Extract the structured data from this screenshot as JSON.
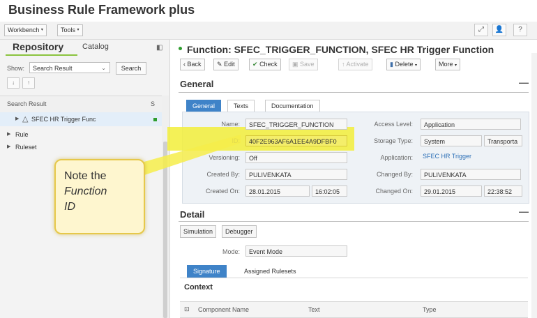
{
  "app": {
    "title": "Business Rule Framework plus"
  },
  "menubar": {
    "workbench": "Workbench",
    "tools": "Tools"
  },
  "left_panel": {
    "tab_repository": "Repository",
    "tab_catalog": "Catalog",
    "show_label": "Show:",
    "show_value": "Search Result",
    "search_button": "Search",
    "results_header": "Search Result",
    "results_col_s": "S",
    "tree": [
      {
        "label": "SFEC HR Trigger Func"
      },
      {
        "label": "Rule"
      },
      {
        "label": "Ruleset"
      }
    ]
  },
  "function": {
    "title": "Function: SFEC_TRIGGER_FUNCTION, SFEC HR Trigger Function"
  },
  "toolbar": {
    "back": "Back",
    "edit": "Edit",
    "check": "Check",
    "save": "Save",
    "activate": "Activate",
    "delete": "Delete",
    "more": "More"
  },
  "general": {
    "title": "General",
    "tabs": [
      "General",
      "Texts",
      "Documentation"
    ],
    "fields": {
      "name_label": "Name:",
      "name_value": "SFEC_TRIGGER_FUNCTION",
      "id_label": "ID:",
      "id_value": "40F2E963AF6A1EE4A9DFBF0",
      "versioning_label": "Versioning:",
      "versioning_value": "Off",
      "created_by_label": "Created By:",
      "created_by_value": "PULIVENKATA",
      "created_on_label": "Created On:",
      "created_on_date": "28.01.2015",
      "created_on_time": "16:02:05",
      "access_level_label": "Access Level:",
      "access_level_value": "Application",
      "storage_type_label": "Storage Type:",
      "storage_type_value": "System",
      "storage_type_value2": "Transporta",
      "application_label": "Application:",
      "application_value": "SFEC HR Trigger",
      "changed_by_label": "Changed By:",
      "changed_by_value": "PULIVENKATA",
      "changed_on_label": "Changed On:",
      "changed_on_date": "29.01.2015",
      "changed_on_time": "22:38:52"
    }
  },
  "callout": {
    "line1": "Note the",
    "line2": "Function",
    "line3": "ID"
  },
  "detail": {
    "title": "Detail",
    "simulation": "Simulation",
    "debugger": "Debugger",
    "mode_label": "Mode:",
    "mode_value": "Event Mode",
    "tabs": [
      "Signature",
      "Assigned Rulesets"
    ],
    "context_title": "Context",
    "columns": [
      "Component Name",
      "Text",
      "Type"
    ]
  }
}
